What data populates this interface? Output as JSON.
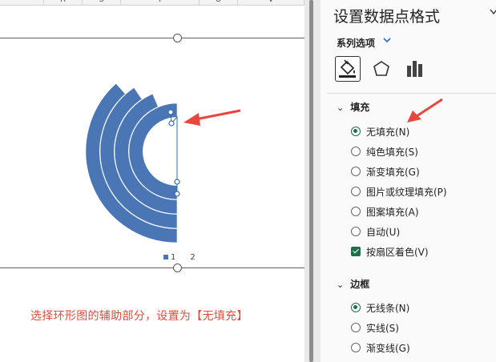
{
  "spreadsheet": {
    "column_headers": [
      "R",
      "S",
      "T",
      "U",
      "V"
    ],
    "annotation_text": "选择环形图的辅助部分，设置为【无填充】"
  },
  "chart_data": {
    "type": "doughnut",
    "rings": 4,
    "legend": [
      "1",
      "2"
    ],
    "series_color": "#4a76b5",
    "title": "",
    "note": ""
  },
  "format_pane": {
    "title": "设置数据点格式",
    "series_options_label": "系列选项",
    "tabs": [
      {
        "name": "fill-line",
        "icon": "paint-bucket-icon",
        "active": true
      },
      {
        "name": "effects",
        "icon": "pentagon-icon",
        "active": false
      },
      {
        "name": "series-options",
        "icon": "bar-chart-icon",
        "active": false
      }
    ],
    "fill_section": {
      "heading": "填充",
      "options": [
        {
          "label": "无填充(N)",
          "type": "radio",
          "checked": true
        },
        {
          "label": "纯色填充(S)",
          "type": "radio",
          "checked": false
        },
        {
          "label": "渐变填充(G)",
          "type": "radio",
          "checked": false
        },
        {
          "label": "图片或纹理填充(P)",
          "type": "radio",
          "checked": false
        },
        {
          "label": "图案填充(A)",
          "type": "radio",
          "checked": false
        },
        {
          "label": "自动(U)",
          "type": "radio",
          "checked": false
        },
        {
          "label": "按扇区着色(V)",
          "type": "checkbox",
          "checked": true
        }
      ]
    },
    "border_section": {
      "heading": "边框",
      "options": [
        {
          "label": "无线条(N)",
          "type": "radio",
          "checked": true
        },
        {
          "label": "实线(S)",
          "type": "radio",
          "checked": false
        },
        {
          "label": "渐变线(G)",
          "type": "radio",
          "checked": false
        }
      ]
    }
  },
  "colors": {
    "accent_green": "#1e6f4a",
    "arrow_red": "#e8473d",
    "chart_blue": "#4a76b5"
  }
}
